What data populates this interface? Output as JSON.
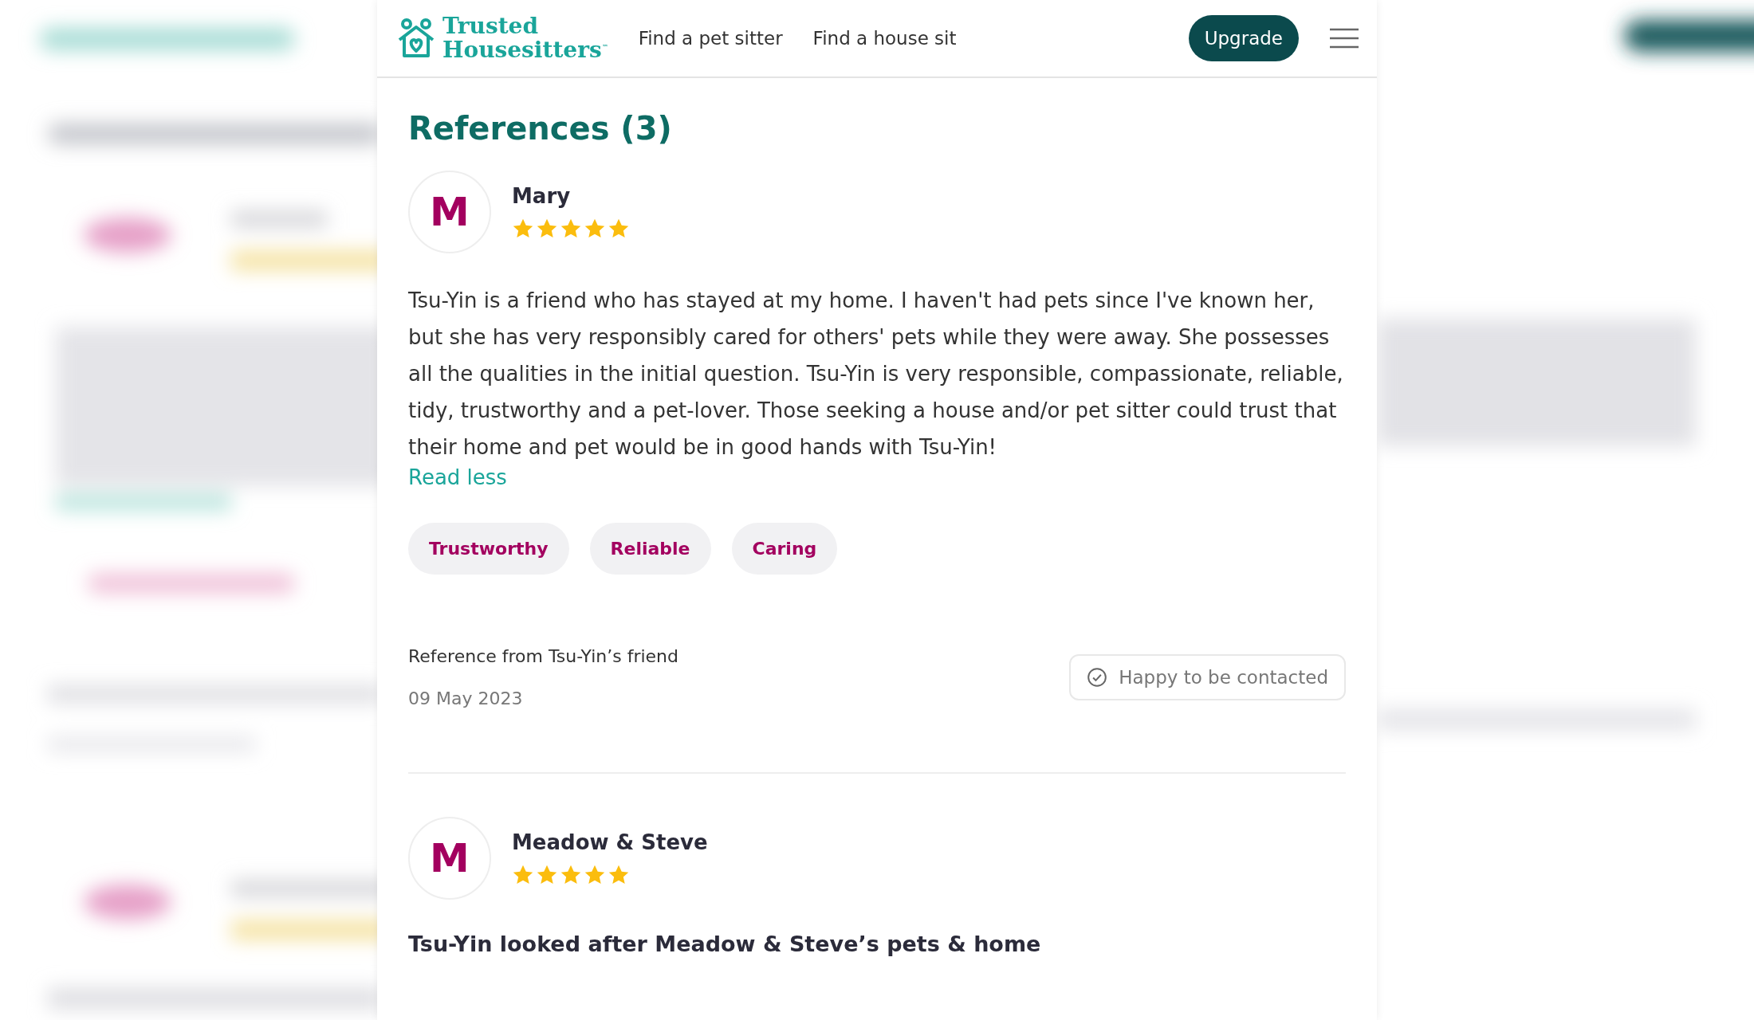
{
  "header": {
    "logo": {
      "line1": "Trusted",
      "line2": "Housesitters",
      "mark": "™"
    },
    "nav": [
      {
        "label": "Find a pet sitter"
      },
      {
        "label": "Find a house sit"
      }
    ],
    "upgrade": "Upgrade"
  },
  "section": {
    "title": "References (3)"
  },
  "references": [
    {
      "initial": "M",
      "name": "Mary",
      "stars": 5,
      "text": "Tsu-Yin is a friend who has stayed at my home. I haven't had pets since I've known her, but she has very responsibly cared for others' pets while they were away. She possesses all the qualities in the initial question. Tsu-Yin is very responsible, compassionate, reliable, tidy, trustworthy and a pet-lover. Those seeking a house and/or pet sitter could trust that their home and pet would be in good hands with Tsu-Yin!",
      "toggle": "Read less",
      "tags": [
        "Trustworthy",
        "Reliable",
        "Caring"
      ],
      "relation": "Reference from Tsu-Yin’s friend",
      "date": "09 May 2023",
      "contact": "Happy to be contacted"
    },
    {
      "initial": "M",
      "name": "Meadow & Steve",
      "stars": 5,
      "headline": "Tsu-Yin looked after Meadow & Steve’s pets & home"
    }
  ]
}
